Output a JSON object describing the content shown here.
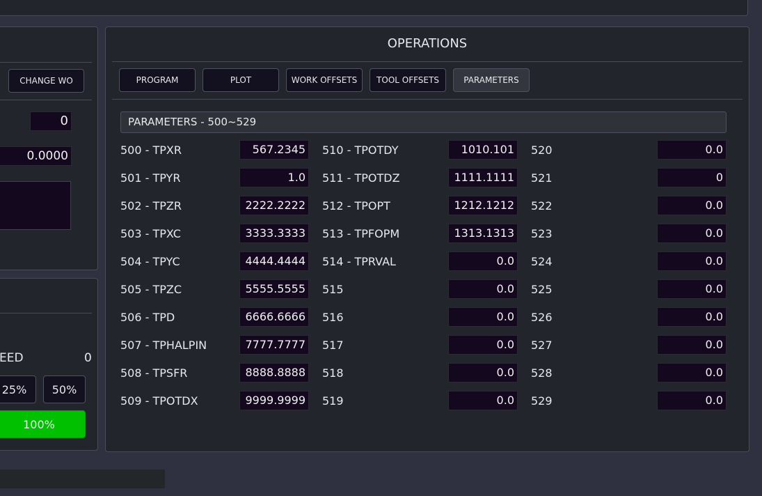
{
  "left_panel": {
    "change_wo_label": "CHANGE WO",
    "wo_value": "0",
    "coord_value": "0.0000"
  },
  "left_speed": {
    "speed_label": "SPEED",
    "speed_value": "0",
    "btn_25": "25%",
    "btn_50": "50%",
    "btn_100": "100%"
  },
  "operations": {
    "title": "OPERATIONS",
    "tabs": [
      {
        "label": "PROGRAM"
      },
      {
        "label": "PLOT"
      },
      {
        "label": "WORK OFFSETS"
      },
      {
        "label": "TOOL OFFSETS"
      },
      {
        "label": "PARAMETERS",
        "active": true
      }
    ],
    "section_title": "PARAMETERS - 500~529",
    "params": [
      {
        "label": "500 - TPXR",
        "value": "567.2345"
      },
      {
        "label": "501 - TPYR",
        "value": "1.0"
      },
      {
        "label": "502 - TPZR",
        "value": "2222.2222"
      },
      {
        "label": "503 - TPXC",
        "value": "3333.3333"
      },
      {
        "label": "504 - TPYC",
        "value": "4444.4444"
      },
      {
        "label": "505 - TPZC",
        "value": "5555.5555"
      },
      {
        "label": "506 - TPD",
        "value": "6666.6666"
      },
      {
        "label": "507 - TPHALPIN",
        "value": "7777.7777"
      },
      {
        "label": "508 - TPSFR",
        "value": "8888.8888"
      },
      {
        "label": "509 - TPOTDX",
        "value": "9999.9999"
      },
      {
        "label": "510 - TPOTDY",
        "value": "1010.101"
      },
      {
        "label": "511 - TPOTDZ",
        "value": "1111.1111"
      },
      {
        "label": "512 - TPOPT",
        "value": "1212.1212"
      },
      {
        "label": "513 - TPFOPM",
        "value": "1313.1313"
      },
      {
        "label": "514 - TPRVAL",
        "value": "0.0"
      },
      {
        "label": "515",
        "value": "0.0"
      },
      {
        "label": "516",
        "value": "0.0"
      },
      {
        "label": "517",
        "value": "0.0"
      },
      {
        "label": "518",
        "value": "0.0"
      },
      {
        "label": "519",
        "value": "0.0"
      },
      {
        "label": "520",
        "value": "0.0"
      },
      {
        "label": "521",
        "value": "0"
      },
      {
        "label": "522",
        "value": "0.0"
      },
      {
        "label": "523",
        "value": "0.0"
      },
      {
        "label": "524",
        "value": "0.0"
      },
      {
        "label": "525",
        "value": "0.0"
      },
      {
        "label": "526",
        "value": "0.0"
      },
      {
        "label": "527",
        "value": "0.0"
      },
      {
        "label": "528",
        "value": "0.0"
      },
      {
        "label": "529",
        "value": "0.0"
      }
    ]
  },
  "colors": {
    "accent_green": "#00c000",
    "field_bg": "#14081f",
    "panel_bg": "#23252c",
    "page_bg": "#2f3140"
  }
}
